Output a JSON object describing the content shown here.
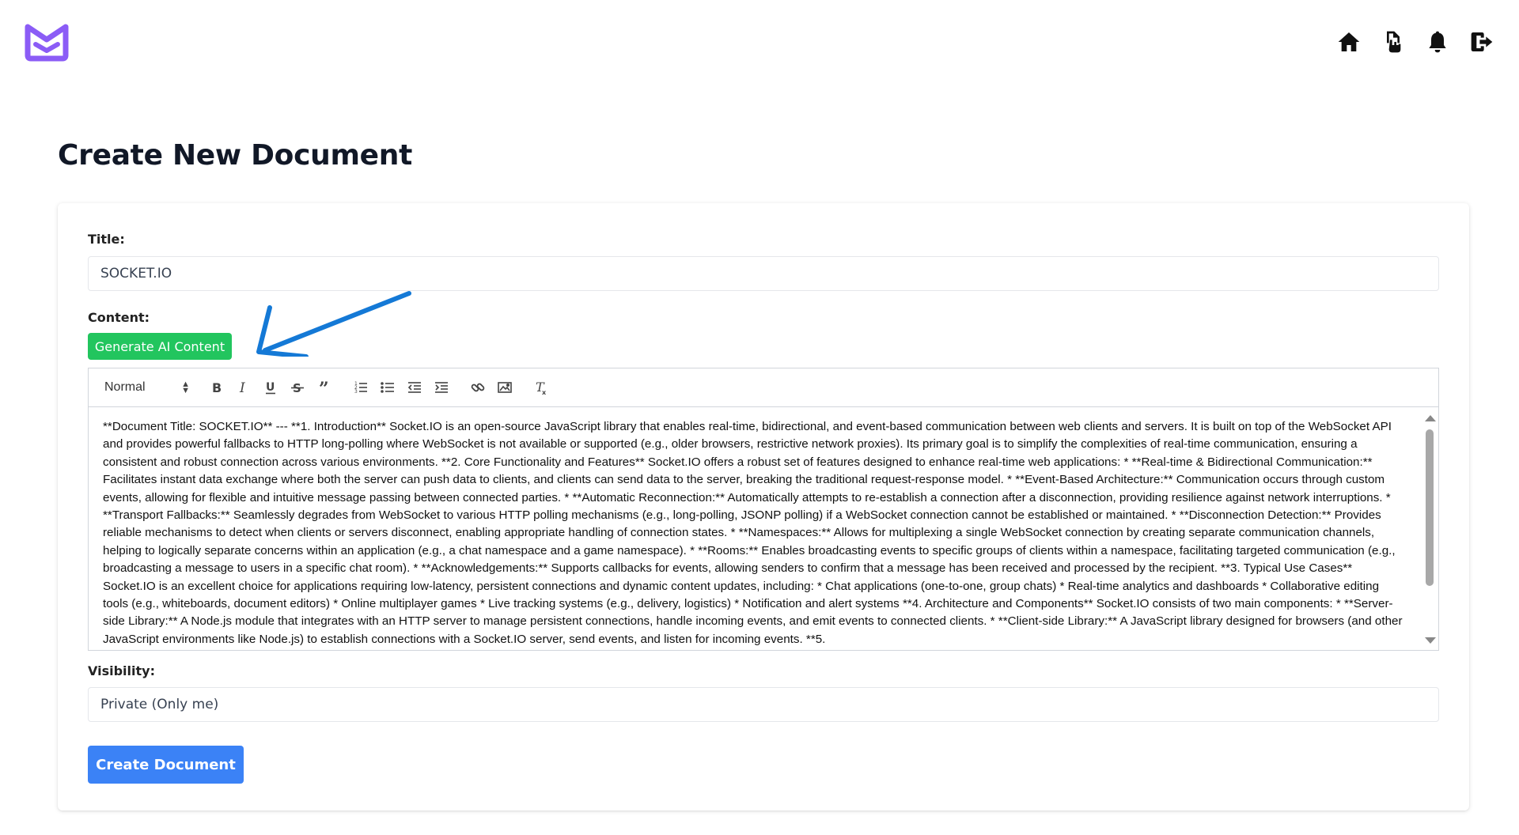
{
  "colors": {
    "brand": "#8b5cf6",
    "ai_button": "#22c55e",
    "primary_button": "#3b82f6",
    "annotation_arrow": "#1479d6"
  },
  "header": {
    "nav": [
      "home-icon",
      "documents-icon",
      "notifications-icon",
      "logout-icon"
    ]
  },
  "page": {
    "title": "Create New Document"
  },
  "form": {
    "title_label": "Title:",
    "title_value": "SOCKET.IO",
    "content_label": "Content:",
    "ai_button": "Generate AI Content",
    "visibility_label": "Visibility:",
    "visibility_value": "Private (Only me)",
    "submit_button": "Create Document"
  },
  "editor": {
    "heading_select": "Normal",
    "toolbar": [
      "bold",
      "italic",
      "underline",
      "strike",
      "blockquote",
      "ordered-list",
      "bullet-list",
      "outdent",
      "indent",
      "link",
      "image",
      "clear-format"
    ],
    "content": "**Document Title: SOCKET.IO** --- **1. Introduction** Socket.IO is an open-source JavaScript library that enables real-time, bidirectional, and event-based communication between web clients and servers. It is built on top of the WebSocket API and provides powerful fallbacks to HTTP long-polling where WebSocket is not available or supported (e.g., older browsers, restrictive network proxies). Its primary goal is to simplify the complexities of real-time communication, ensuring a consistent and robust connection across various environments. **2. Core Functionality and Features** Socket.IO offers a robust set of features designed to enhance real-time web applications: * **Real-time & Bidirectional Communication:** Facilitates instant data exchange where both the server can push data to clients, and clients can send data to the server, breaking the traditional request-response model. * **Event-Based Architecture:** Communication occurs through custom events, allowing for flexible and intuitive message passing between connected parties. * **Automatic Reconnection:** Automatically attempts to re-establish a connection after a disconnection, providing resilience against network interruptions. * **Transport Fallbacks:** Seamlessly degrades from WebSocket to various HTTP polling mechanisms (e.g., long-polling, JSONP polling) if a WebSocket connection cannot be established or maintained. * **Disconnection Detection:** Provides reliable mechanisms to detect when clients or servers disconnect, enabling appropriate handling of connection states. * **Namespaces:** Allows for multiplexing a single WebSocket connection by creating separate communication channels, helping to logically separate concerns within an application (e.g., a chat namespace and a game namespace). * **Rooms:** Enables broadcasting events to specific groups of clients within a namespace, facilitating targeted communication (e.g., broadcasting a message to users in a specific chat room). * **Acknowledgements:** Supports callbacks for events, allowing senders to confirm that a message has been received and processed by the recipient. **3. Typical Use Cases** Socket.IO is an excellent choice for applications requiring low-latency, persistent connections and dynamic content updates, including: * Chat applications (one-to-one, group chats) * Real-time analytics and dashboards * Collaborative editing tools (e.g., whiteboards, document editors) * Online multiplayer games * Live tracking systems (e.g., delivery, logistics) * Notification and alert systems **4. Architecture and Components** Socket.IO consists of two main components: * **Server-side Library:** A Node.js module that integrates with an HTTP server to manage persistent connections, handle incoming events, and emit events to connected clients. * **Client-side Library:** A JavaScript library designed for browsers (and other JavaScript environments like Node.js) to establish connections with a Socket.IO server, send events, and listen for incoming events. **5."
  }
}
